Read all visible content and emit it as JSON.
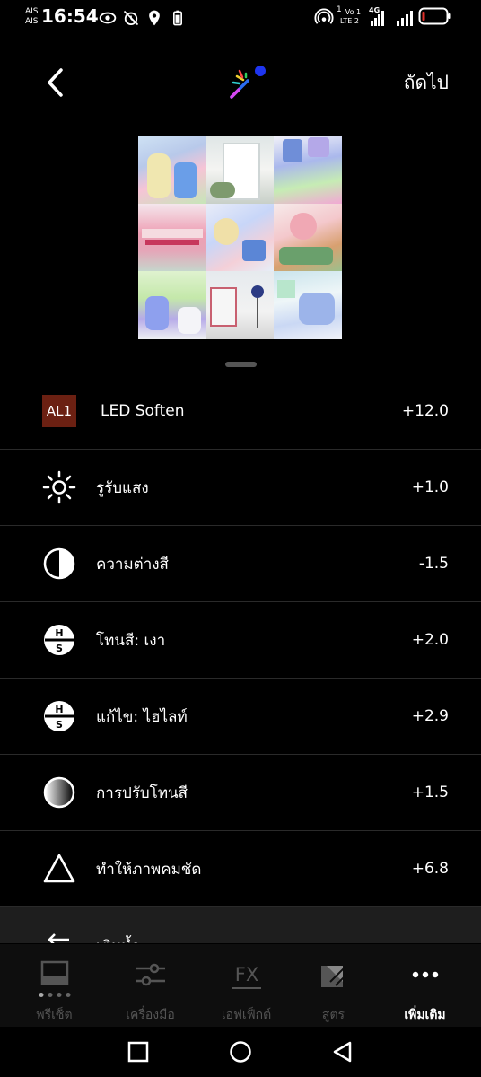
{
  "status_bar": {
    "carrier_top": "AIS",
    "carrier_bottom": "AIS",
    "time": "16:54",
    "sim_indicator": "1",
    "network_vo": "Vo",
    "network_lte": "LTE",
    "network_4g": "4G",
    "network_sim2": "1",
    "network_lte2": "2"
  },
  "top_bar": {
    "next_label": "ถัดไป"
  },
  "adjustments": [
    {
      "badge": "AL1",
      "label": "LED Soften",
      "value": "+12.0",
      "icon": "al1-badge"
    },
    {
      "label": "รูรับแสง",
      "value": "+1.0",
      "icon": "sun-icon"
    },
    {
      "label": "ความต่างสี",
      "value": "-1.5",
      "icon": "contrast-icon"
    },
    {
      "label": "โทนสี: เงา",
      "value": "+2.0",
      "icon": "hs-icon"
    },
    {
      "label": "แก้ไข: ไฮไลท์",
      "value": "+2.9",
      "icon": "hs-icon"
    },
    {
      "label": "การปรับโทนสี",
      "value": "+1.5",
      "icon": "gradient-circle-icon"
    },
    {
      "label": "ทำให้ภาพคมชัด",
      "value": "+6.8",
      "icon": "triangle-icon"
    },
    {
      "label": "เติมน้ำ",
      "value": "",
      "icon": "undo-icon"
    }
  ],
  "toolbar": {
    "tools": [
      {
        "label": "พรีเซ็ต",
        "icon": "preset-icon",
        "active": false
      },
      {
        "label": "เครื่องมือ",
        "icon": "sliders-icon",
        "active": false
      },
      {
        "label": "เอฟเฟ็กต์",
        "icon": "fx-icon",
        "active": false
      },
      {
        "label": "สูตร",
        "icon": "recipe-icon",
        "active": false
      },
      {
        "label": "เพิ่มเติม",
        "icon": "more-icon",
        "active": true
      }
    ]
  },
  "colors": {
    "background": "#000000",
    "divider": "#2a2a2a",
    "badge": "#6b2012",
    "inactive": "#555555"
  }
}
